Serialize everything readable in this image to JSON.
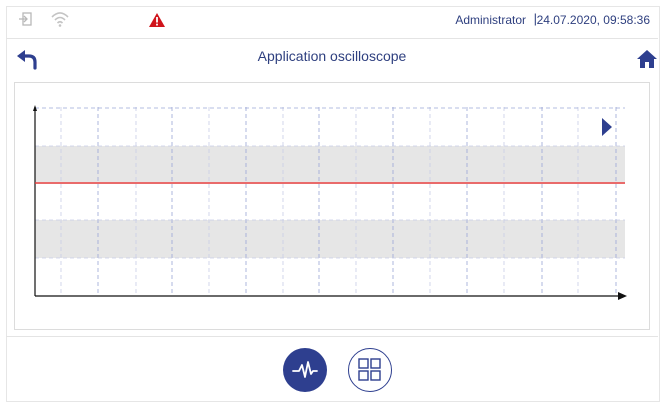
{
  "status_bar": {
    "user": "Administrator",
    "separator": "|",
    "datetime": "24.07.2020, 09:58:36",
    "icons": [
      "login-icon",
      "wifi-icon",
      "alarm-warning-icon"
    ],
    "alarm_color": "#d0141b"
  },
  "header": {
    "title": "Application oscilloscope",
    "icons": [
      "back-arrow-icon",
      "home-icon"
    ],
    "accent_color": "#2e3f8f"
  },
  "oscilloscope": {
    "signal_color": "#e23a3a",
    "band_color": "#e6e6e6",
    "grid_color": "#9aa6d6",
    "icons": [
      "play-arrow-icon"
    ]
  },
  "footer": {
    "buttons": [
      "oscilloscope-waveform-icon",
      "grid-view-icon"
    ]
  }
}
